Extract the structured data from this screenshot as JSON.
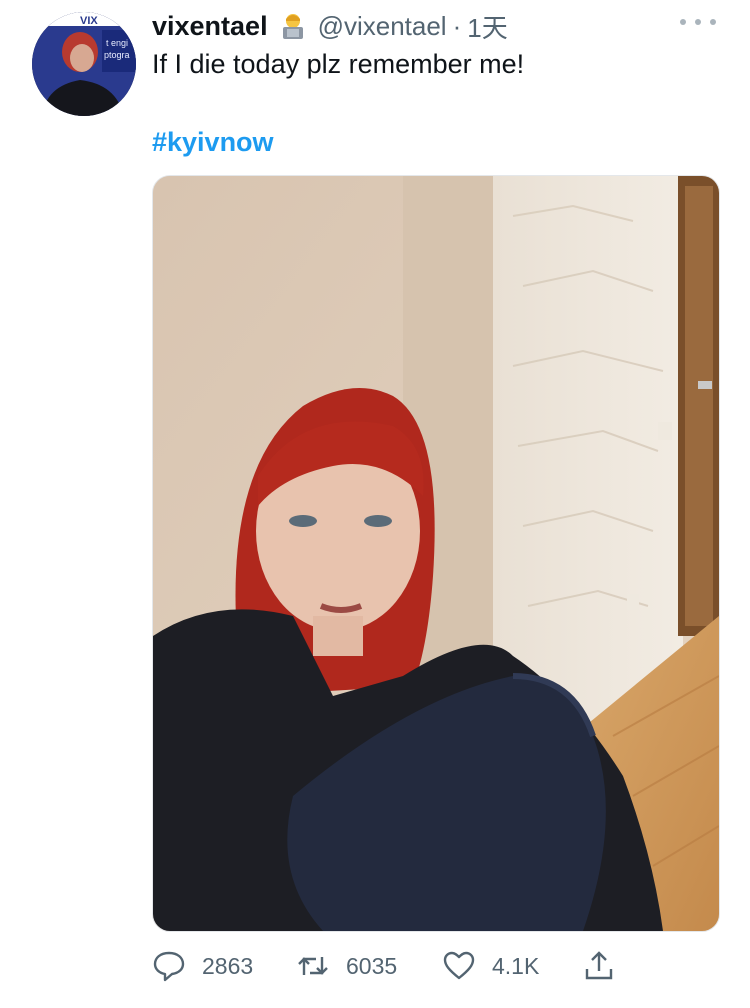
{
  "tweet": {
    "display_name": "vixentael",
    "handle": "@vixentael",
    "dot": "·",
    "time": "1天",
    "text": "If I die today plz remember me!",
    "hashtag": "#kyivnow",
    "badge_emoji": "woman-technologist-emoji",
    "avatar_background_text": [
      "VIX",
      "t engi",
      "ptogra"
    ]
  },
  "actions": {
    "reply_count": "2863",
    "retweet_count": "6035",
    "like_count": "4.1K"
  },
  "icons": {
    "more": "more-horizontal-icon",
    "reply": "reply-icon",
    "retweet": "retweet-icon",
    "like": "heart-icon",
    "share": "share-icon"
  },
  "colors": {
    "link": "#1d9bf0",
    "muted": "#536471",
    "text": "#0f1419"
  }
}
